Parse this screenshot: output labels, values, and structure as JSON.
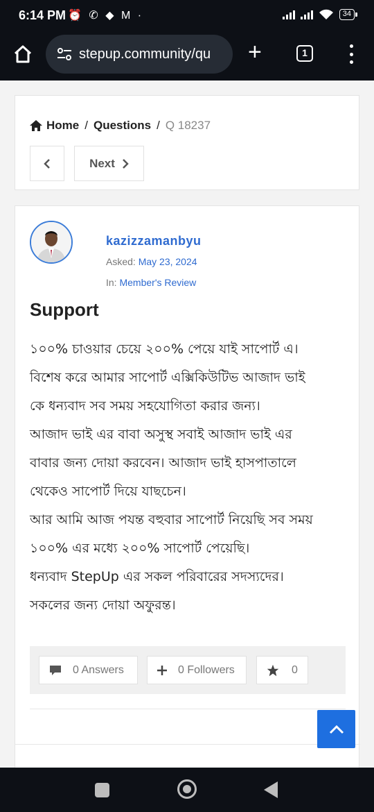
{
  "status_bar": {
    "time": "6:14 PM",
    "left_icons": "⏰ ✆ ◆ M ·",
    "battery": "34"
  },
  "browser": {
    "url": "stepup.community/qu",
    "tab_count": "1"
  },
  "breadcrumb": {
    "home": "Home",
    "sep1": "/",
    "questions": "Questions",
    "sep2": "/",
    "current": "Q 18237"
  },
  "pagination": {
    "next": "Next"
  },
  "question": {
    "author": "kazizzamanbyu",
    "asked_label": "Asked:",
    "asked_date": "May 23, 2024",
    "in_label": "In:",
    "category": "Member's Review",
    "title": "Support",
    "body": [
      "১০০% চাওয়ার চেয়ে ২০০% পেয়ে যাই সাপোর্ট এ।",
      "বিশেষ করে আমার সাপোর্ট এক্সিকিউটিভ আজাদ ভাই",
      "কে ধন্যবাদ সব সময় সহযোগিতা করার জন্য।",
      "আজাদ ভাই এর বাবা অসুস্থ সবাই আজাদ ভাই এর",
      "বাবার জন্য দোয়া করবেন। আজাদ ভাই হাসপাতালে",
      "থেকেও সাপোর্ট দিয়ে যাছচেন।",
      "আর আমি আজ পযন্ত বহুবার সাপোর্ট নিয়েছি সব সময়",
      "১০০% এর মধ্যে ২০০% সাপোর্ট পেয়েছি।",
      "ধন্যবাদ StepUp এর সকল পরিবারের সদস্যদের।",
      "সকলের জন্য দোয়া অফুরন্ত।"
    ],
    "answers": "0 Answers",
    "followers": "0 Followers",
    "stars": "0"
  },
  "colors": {
    "accent": "#2f6bd0",
    "scroll_top": "#1e6fe0",
    "system_bar": "#0d1016"
  }
}
